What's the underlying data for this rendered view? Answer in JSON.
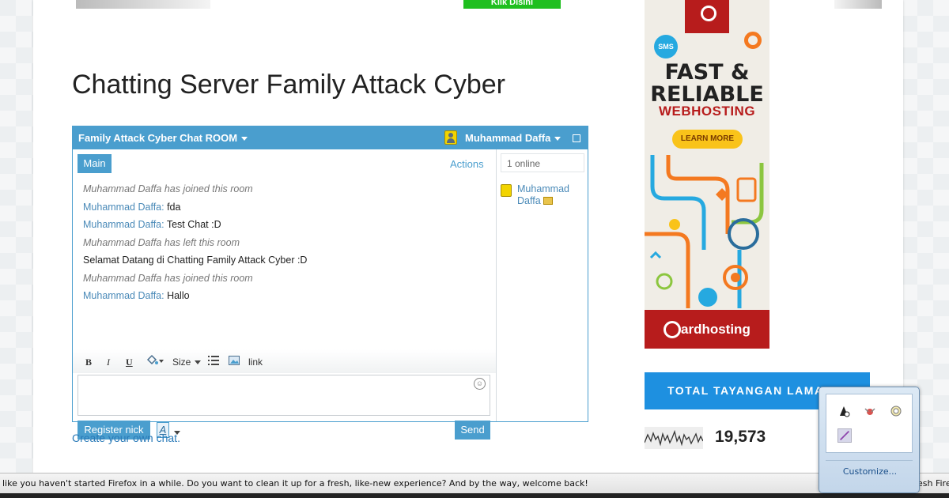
{
  "banner": {
    "button_label": "Klik Disini"
  },
  "post": {
    "title": "Chatting Server Family Attack Cyber"
  },
  "chat": {
    "room_title": "Family Attack Cyber Chat ROOM",
    "current_user": "Muhammad Daffa",
    "tab_main": "Main",
    "actions_label": "Actions",
    "messages": [
      {
        "type": "system",
        "text": "Muhammad Daffa has joined this room"
      },
      {
        "type": "user",
        "nick": "Muhammad Daffa:",
        "text": " fda"
      },
      {
        "type": "user",
        "nick": "Muhammad Daffa:",
        "text": " Test Chat :D"
      },
      {
        "type": "system",
        "text": "Muhammad Daffa has left this room"
      },
      {
        "type": "plain",
        "text": "Selamat Datang di Chatting Family Attack Cyber :D"
      },
      {
        "type": "system",
        "text": "Muhammad Daffa has joined this room"
      },
      {
        "type": "user",
        "nick": "Muhammad Daffa:",
        "text": " Hallo"
      }
    ],
    "toolbar": {
      "bold": "B",
      "italic": "I",
      "underline": "U",
      "size": "Size",
      "link": "link"
    },
    "input_value": "",
    "register_label": "Register nick",
    "font_button": "A",
    "send_label": "Send",
    "online_count": "1 online",
    "online_users": [
      "Muhammad Daffa"
    ]
  },
  "create_link": "Create your own chat.",
  "ad": {
    "sms": "SMS",
    "headline": "FAST & RELIABLE",
    "subline": "WEBHOSTING",
    "cta": "LEARN MORE",
    "brand": "ardhosting"
  },
  "widget": {
    "title": "TOTAL TAYANGAN LAMAN",
    "views": "19,573"
  },
  "notification": {
    "text": "like you haven't started Firefox in a while. Do you want to clean it up for a fresh, like-new experience? And by the way, welcome back!",
    "text_right": "esh Fire"
  },
  "tray": {
    "customize_label": "Customize..."
  },
  "colors": {
    "accent": "#4a9ece",
    "ad_red": "#b71c1c",
    "widget_blue": "#1e90e0"
  }
}
